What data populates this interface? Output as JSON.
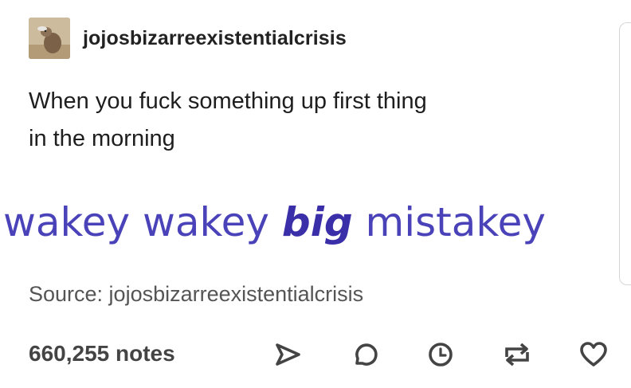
{
  "post": {
    "blog_name": "jojosbizarreexistentialcrisis",
    "avatar_icon": "dog-avatar-icon",
    "caption_line1": "When you fuck something up first thing",
    "caption_line2": "in the morning",
    "meme": {
      "part1": "wakey wakey ",
      "part2": "big",
      "part3": " mistakey",
      "color": "#4a42b8"
    },
    "source": "Source: jojosbizarreexistentialcrisis",
    "notes": "660,255 notes",
    "actions": [
      "share-icon",
      "reply-icon",
      "clock-icon",
      "reblog-icon",
      "heart-icon"
    ]
  }
}
